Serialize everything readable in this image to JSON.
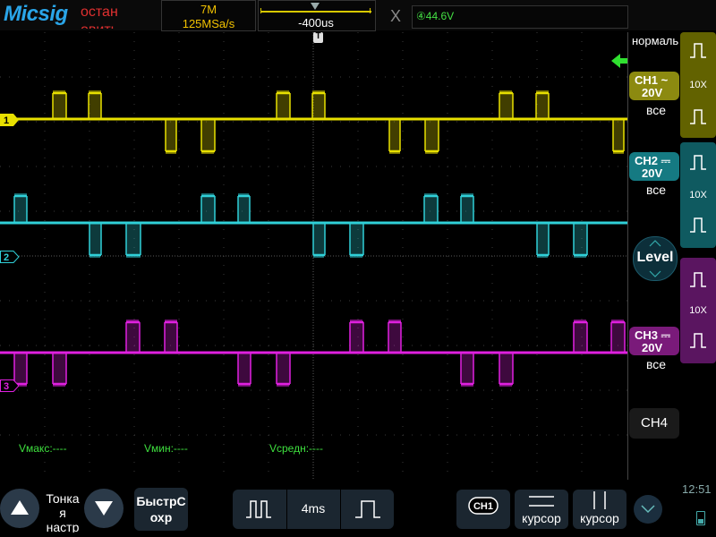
{
  "app": {
    "logo": "Micsig",
    "status_line1": "остан",
    "status_line2": "овить"
  },
  "acquisition": {
    "memory_depth": "7M",
    "sample_rate": "125MSa/s"
  },
  "timebase": {
    "trigger_position": "-400us",
    "scale": "4ms"
  },
  "trigger": {
    "source_symbol": "④",
    "level": "44.6V",
    "mode": "нормаль",
    "x_symbol": "X"
  },
  "channels": [
    {
      "id": "1",
      "name": "CH1",
      "coupling": "~",
      "scale": "20V",
      "bandwidth": "все",
      "probe": "10X",
      "color": "#e8e000",
      "badge_bg": "#8c8a10",
      "probe_bg": "#626200"
    },
    {
      "id": "2",
      "name": "CH2",
      "coupling": "⎓",
      "scale": "20V",
      "bandwidth": "все",
      "probe": "10X",
      "color": "#30d0d8",
      "badge_bg": "#157a82",
      "probe_bg": "#0f5a60"
    },
    {
      "id": "3",
      "name": "CH3",
      "coupling": "⎓",
      "scale": "20V",
      "bandwidth": "все",
      "probe": "10X",
      "color": "#e020e0",
      "badge_bg": "#7a1a7a",
      "probe_bg": "#5a1560"
    }
  ],
  "ch4_label": "CH4",
  "level_label": "Level",
  "measurements": {
    "vmax": "Vмакс:----",
    "vmin": "Vмин:----",
    "vavg": "Vсредн:----"
  },
  "bottom": {
    "fine_label_1": "Тонка",
    "fine_label_2": "я",
    "fine_label_3": "настр",
    "quick_save_1": "БыстрС",
    "quick_save_2": "охр",
    "cursor_badge": "CH1",
    "cursor_label_1": "курсор",
    "cursor_label_2": "курсор"
  },
  "clock": "12:51",
  "icons": {
    "up": "triangle-up-icon",
    "down": "triangle-down-icon",
    "rising": "rising-edge-icon",
    "falling": "falling-edge-icon",
    "chevron": "chevron-down-icon",
    "battery": "battery-icon"
  }
}
